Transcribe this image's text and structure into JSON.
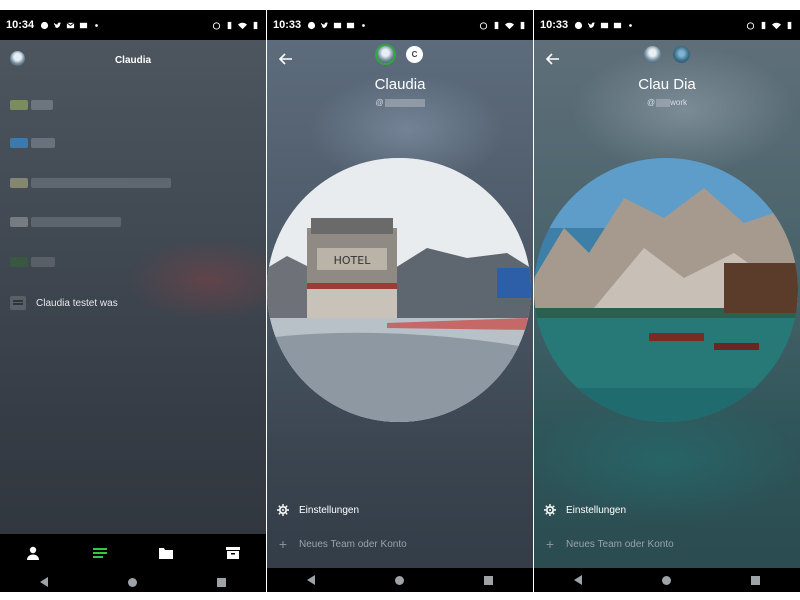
{
  "screens": [
    {
      "status": {
        "time": "10:34"
      },
      "header": {
        "title": "Claudia"
      },
      "list": {
        "item_label": "Claudia testet was"
      },
      "bottom_nav": [
        "contacts-icon",
        "chats-icon",
        "files-icon",
        "archive-icon"
      ],
      "bottom_nav_active_color": "#2ecc40"
    },
    {
      "status": {
        "time": "10:33"
      },
      "profile": {
        "name": "Claudia",
        "handle": "@",
        "handle_suffix": ""
      },
      "accounts": [
        "avatar-mountain",
        "C"
      ],
      "menu": {
        "settings_label": "Einstellungen",
        "new_label": "Neues Team oder Konto"
      }
    },
    {
      "status": {
        "time": "10:33"
      },
      "profile": {
        "name": "Clau Dia",
        "handle": "@",
        "handle_suffix": "work"
      },
      "accounts": [
        "avatar-mountain",
        "avatar-lake"
      ],
      "menu": {
        "settings_label": "Einstellungen",
        "new_label": "Neues Team oder Konto"
      }
    }
  ],
  "colors": {
    "accent_active": "#2faa3a",
    "nav_bg": "#000000"
  }
}
